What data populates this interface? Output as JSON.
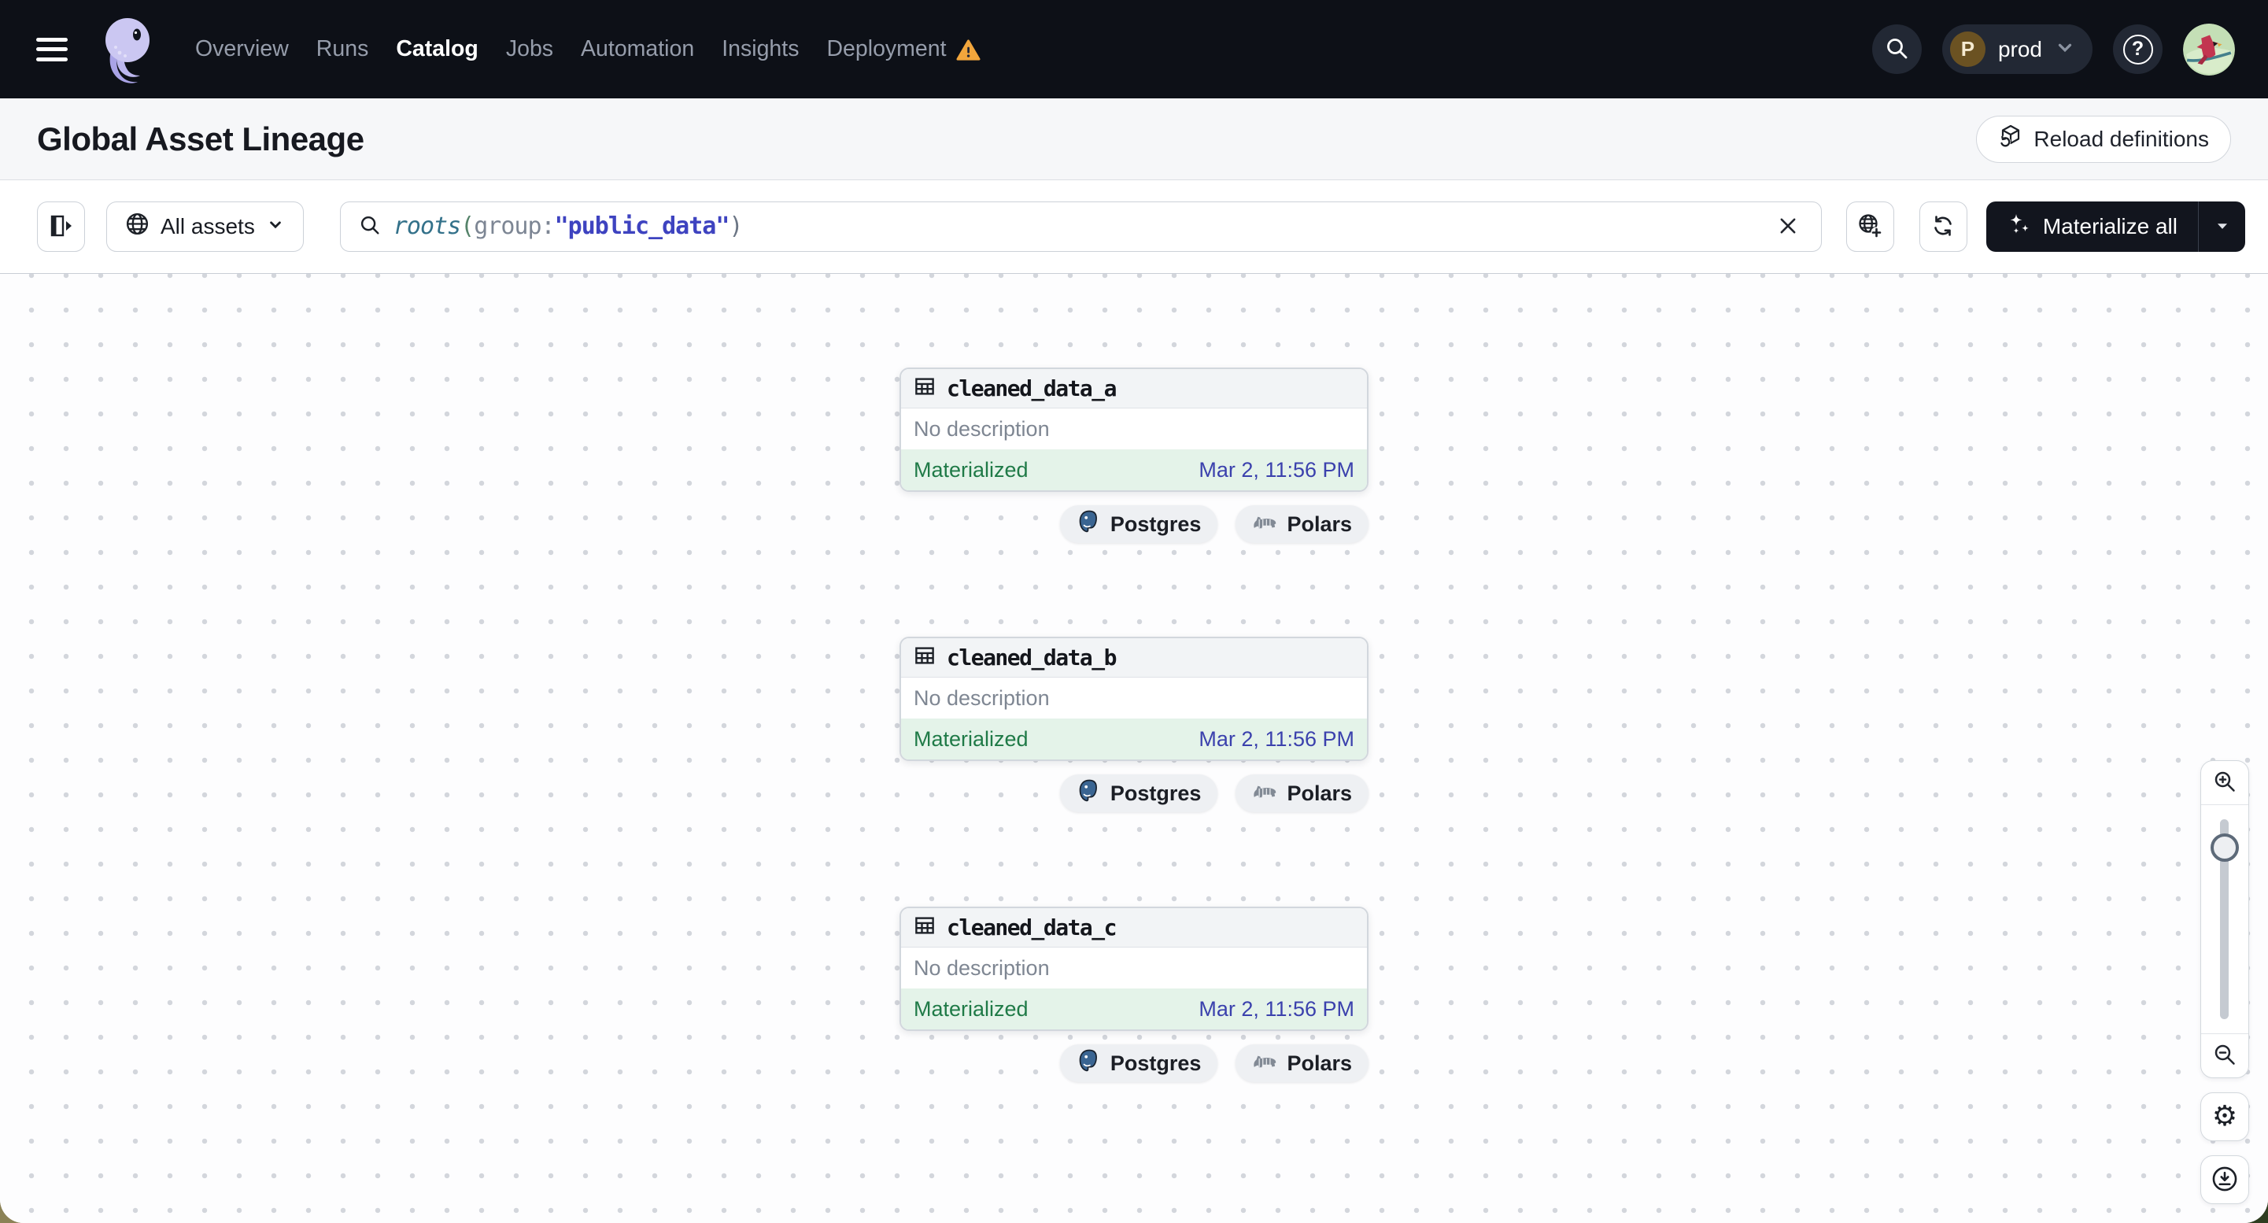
{
  "nav": {
    "items": [
      {
        "label": "Overview",
        "active": false
      },
      {
        "label": "Runs",
        "active": false
      },
      {
        "label": "Catalog",
        "active": true
      },
      {
        "label": "Jobs",
        "active": false
      },
      {
        "label": "Automation",
        "active": false
      },
      {
        "label": "Insights",
        "active": false
      },
      {
        "label": "Deployment",
        "active": false,
        "warning": true
      }
    ],
    "deployment_name": "prod",
    "deployment_initial": "P",
    "help_glyph": "?"
  },
  "header": {
    "title": "Global Asset Lineage",
    "reload_label": "Reload definitions"
  },
  "toolbar": {
    "scope_label": "All assets",
    "materialize_label": "Materialize all",
    "query": {
      "fn": "roots",
      "open": "(",
      "key": "group:",
      "value": "\"public_data\"",
      "close": ")"
    }
  },
  "graph": {
    "nodes": [
      {
        "name": "cleaned_data_a",
        "description": "No description",
        "status": "Materialized",
        "timestamp": "Mar 2, 11:56 PM",
        "tags": [
          "Postgres",
          "Polars"
        ]
      },
      {
        "name": "cleaned_data_b",
        "description": "No description",
        "status": "Materialized",
        "timestamp": "Mar 2, 11:56 PM",
        "tags": [
          "Postgres",
          "Polars"
        ]
      },
      {
        "name": "cleaned_data_c",
        "description": "No description",
        "status": "Materialized",
        "timestamp": "Mar 2, 11:56 PM",
        "tags": [
          "Postgres",
          "Polars"
        ]
      }
    ],
    "settings_glyph": "⚙"
  },
  "colors": {
    "navbar_bg": "#0d1017",
    "accent_dark": "#12151e",
    "materialized_green": "#1f7a47",
    "materialized_bg": "#e4f3e9",
    "timestamp_blue": "#3b41ad",
    "warning_orange": "#f2a63c",
    "query_fn": "#33718a",
    "query_open": "#55836a",
    "query_key": "#7d8694",
    "query_value": "#3e43c0",
    "query_close": "#6b7584",
    "postgres_blue": "#3a6592"
  }
}
